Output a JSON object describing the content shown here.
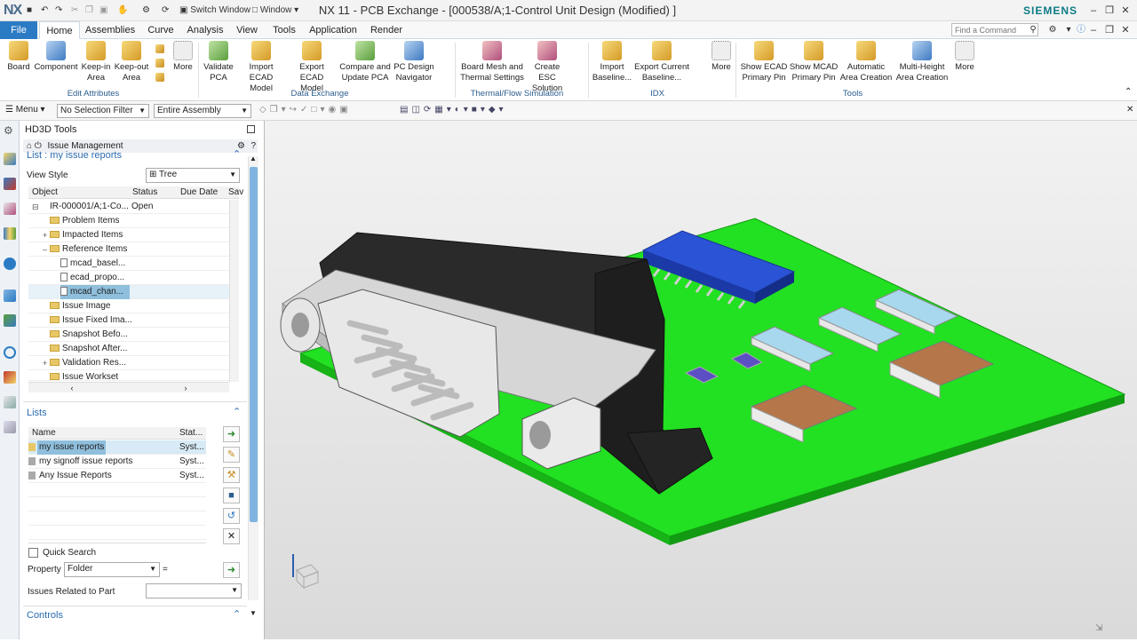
{
  "titlebar": {
    "logo": "NX",
    "switch_window": "Switch Window",
    "window_menu": "Window",
    "title": "NX 11 - PCB Exchange - [000538/A;1-Control Unit Design (Modified) ]",
    "brand": "SIEMENS"
  },
  "tabs": [
    "File",
    "Home",
    "Assemblies",
    "Curve",
    "Analysis",
    "View",
    "Tools",
    "Application",
    "Render"
  ],
  "command_search_placeholder": "Find a Command",
  "ribbon": {
    "buttons": [
      {
        "label": "Board"
      },
      {
        "label": "Component"
      },
      {
        "label": "Keep-in Area"
      },
      {
        "label": "Keep-out Area"
      },
      {
        "label": "More"
      },
      {
        "label": "Validate PCA"
      },
      {
        "label": "Import ECAD Model"
      },
      {
        "label": "Export ECAD Model"
      },
      {
        "label": "Compare and Update PCA"
      },
      {
        "label": "PC Design Navigator"
      },
      {
        "label": "Board Mesh and Thermal Settings"
      },
      {
        "label": "Create ESC Solution"
      },
      {
        "label": "Import Baseline..."
      },
      {
        "label": "Export Current Baseline..."
      },
      {
        "label": "More"
      },
      {
        "label": "Show ECAD Primary Pin"
      },
      {
        "label": "Show MCAD Primary Pin"
      },
      {
        "label": "Automatic Area Creation"
      },
      {
        "label": "Multi-Height Area Creation"
      },
      {
        "label": "More"
      }
    ],
    "groups": [
      "Edit Attributes",
      "Data Exchange",
      "Thermal/Flow Simulation",
      "IDX",
      "Tools"
    ]
  },
  "filterbar": {
    "menu": "Menu",
    "selection_filter": "No Selection Filter",
    "scope": "Entire Assembly"
  },
  "navpanel": {
    "title": "HD3D Tools",
    "issue_management": "Issue Management",
    "list_title": "List : my issue reports",
    "view_style_label": "View Style",
    "view_style_value": "Tree",
    "tree_headers": [
      "Object",
      "Status",
      "Due Date",
      "Sav"
    ],
    "tree_rows": [
      {
        "name": "IR-000001/A;1-Co...",
        "status": "Open"
      },
      {
        "name": "Problem Items",
        "status": ""
      },
      {
        "name": "Impacted Items",
        "status": ""
      },
      {
        "name": "Reference Items",
        "status": ""
      },
      {
        "name": "mcad_basel...",
        "status": ""
      },
      {
        "name": "ecad_propo...",
        "status": ""
      },
      {
        "name": "mcad_chan...",
        "status": ""
      },
      {
        "name": "Issue Image",
        "status": ""
      },
      {
        "name": "Issue Fixed Ima...",
        "status": ""
      },
      {
        "name": "Snapshot Befo...",
        "status": ""
      },
      {
        "name": "Snapshot After...",
        "status": ""
      },
      {
        "name": "Validation Res...",
        "status": ""
      },
      {
        "name": "Issue Workset",
        "status": ""
      }
    ],
    "lists_title": "Lists",
    "lists_headers": [
      "Name",
      "Stat..."
    ],
    "lists_rows": [
      {
        "name": "my issue reports",
        "status": "Syst..."
      },
      {
        "name": "my signoff issue reports",
        "status": "Syst..."
      },
      {
        "name": "Any Issue Reports",
        "status": "Syst..."
      }
    ],
    "quick_search": "Quick Search",
    "property_label": "Property",
    "property_value": "Folder",
    "equals": "=",
    "issues_related": "Issues Related to Part",
    "controls_title": "Controls"
  }
}
